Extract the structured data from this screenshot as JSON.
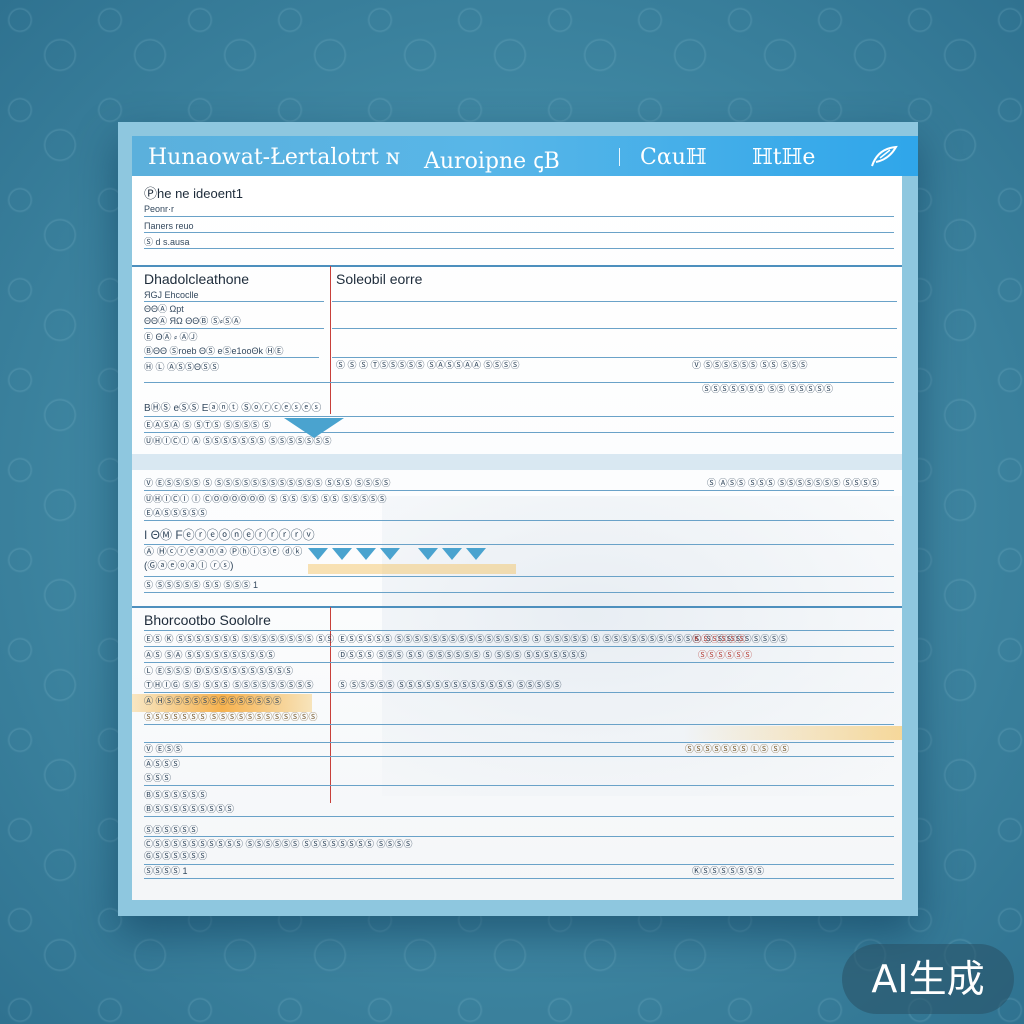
{
  "header": {
    "title_left": "Ηunaowat-Łertalotrt ɴ",
    "title_mid": "Auroipne ꞔΒ",
    "title_c": "Cαuℍ",
    "title_d": "ℍtℍe",
    "leaf_icon": "leaf-icon"
  },
  "section1": {
    "heading": "Ⓟhe ne ideoent1",
    "rows": [
      "Ρeonr·r",
      "Πaners reuo",
      "Ⓢ d s.ausa"
    ]
  },
  "section2": {
    "heading_left": "Dhadolcleathone",
    "heading_right": "Soleobil eorre",
    "left_rows": [
      "ЯGJ Ehcoclle",
      "ΘΘⒶ Ωpt",
      "ΘΘⒶ ЯΩ ΘΘⒷ Ⓢ⸗ⓈⒶ",
      "Ⓔ ΘⒶ ⸗ ⒶⒿ",
      "ⒷΘΘ Ⓢroeb ΘⓈ eⓈe1ooΘk  ⒽⒺ",
      "Ⓗ Ⓛ ⒶⓈⓈΘⓈⓈ"
    ],
    "mid_row": "Ⓢ Ⓢ Ⓢ ⓉⓈⓈⓈⓈⓈ ⓈⒶⓈⓈⒶⒶ ⓈⓈⓈⓈ",
    "right_row1": "Ⓥ ⓈⓈⓈⓈⓈⓈ ⓈⓈ ⓈⓈⓈ",
    "right_row2": "ⓈⓈⓈⓈⓈⓈⓈ ⓈⓈ ⓈⓈⓈⓈⓈ"
  },
  "section3": {
    "heading": "ΒⒽⓈ eⓈⓈ Eⓐⓝⓣ Ⓢⓞⓡⓒⓔⓢⓔⓢ",
    "rows": [
      "ⒺⒶⓈⒶ Ⓢ ⓈⓉⓈ ⓈⓈⓈⓈ Ⓢ",
      "ⓊⒽⒾⒸⒾ Ⓐ ⓈⓈⓈⓈⓈⓈⓈ ⓈⓈⓈⓈⓈⓈⓈ"
    ]
  },
  "section4": {
    "rows": [
      "Ⓥ ⒺⓈⓈⓈⓈ Ⓢ ⓈⓈⓈⓈⓈⓈⓈⓈⓈⓈⓈⓈ ⓈⓈⓈ ⓈⓈⓈⓈ",
      "ⓊⒽⒾⒸⒾ Ⓘ ⒸⓄⓄⓄⓄⓄⓄ Ⓢ ⓈⓈ ⓈⓈ ⓈⓈ ⓈⓈⓈⓈⓈ",
      "ⒺⒶⓈⓈⓈⓈⓈ"
    ],
    "right": "Ⓢ ⒶⓈⓈ ⓈⓈⓈ ⓈⓈⓈⓈⓈⓈⓈ ⓈⓈⓈⓈ"
  },
  "section5": {
    "heading": "I ΘⓂ Fⓔⓡⓔⓞⓝⓔⓡⓡⓡⓡⓥ",
    "rows": [
      "Ⓐ Ⓗⓒⓡⓔⓐⓝⓐ Ⓟⓗⓘⓢⓔ ⓓⓚ",
      "(Ⓖⓐⓔⓞⓐⓛ ⓡⓢ)",
      "Ⓢ  ⓈⓈⓈⓈⓈ ⓈⓈ ⓈⓈⓈ 1"
    ]
  },
  "section6": {
    "heading_left": "Bhorcootbo Soololre",
    "rows_left": [
      "ⒺⓈ Ⓚ ⓈⓈⓈⓈⓈⓈⓈ ⓈⓈⓈⓈⓈⓈⓈⓈ ⓈⓈ",
      "ⒶⓈ ⓈⒶ ⓈⓈⓈⓈⓈⓈⓈⓈⓈⓈ",
      "Ⓛ ⒺⓈⓈⓈ ⒹⓈⓈⓈⓈⓈⓈⓈⓈⓈⓈ",
      "ⓉⒽⒾⒼ ⓈⓈ ⓈⓈⓈ ⓈⓈⓈⓈⓈⓈⓈⓈⓈ",
      "Ⓐ ⒽⓈⓈⓈⓈⓈⓈⓈⓈⓈⓈⓈⓈⓈ",
      "ⓈⓈⓈⓈⓈⓈⓈ ⓈⓈⓈⓈⓈⓈⓈⓈⓈⓈⓈⓈ"
    ],
    "rows_mid": [
      "ⒺⓈⓈⓈⓈⓈ ⓈⓈⓈⓈⓈⓈⓈⓈⓈⓈⓈⓈⓈⓈⓈ Ⓢ ⓈⓈⓈⓈⓈ Ⓢ ⓈⓈⓈⓈⓈⓈⓈⓈⓈⓈⓈ Ⓢ ⓈⓈⓈⓈⓈⓈⓈⓈ",
      "ⒹⓈⓈⓈ ⓈⓈⓈ ⓈⓈ ⓈⓈⓈⓈⓈⓈ Ⓢ ⓈⓈⓈ ⓈⓈⓈⓈⓈⓈⓈ",
      "Ⓢ ⓈⓈⓈⓈⓈ ⓈⓈⓈⓈⓈⓈⓈⓈⓈⓈⓈⓈⓈ ⓈⓈⓈⓈⓈ"
    ],
    "rows_right": [
      "ⓀⓈⓈⓈⓈⓈ",
      "ⓈⓈⓈⓈⓈⓈ"
    ],
    "bottom_left": [
      "Ⓥ ⒺⓈⓈ",
      "ⒶⓈⓈⓈ",
      "ⓈⓈⓈ",
      "ⒷⓈⓈⓈⓈⓈⓈ",
      "ⒷⓈⓈⓈⓈⓈⓈⓈⓈⓈ",
      "ⓈⓈⓈⓈⓈⓈ",
      "ⒸⓈⓈⓈⓈⓈⓈⓈⓈⓈⓈ ⓈⓈⓈⓈⓈⓈ ⓈⓈⓈⓈⓈⓈⓈⓈ ⓈⓈⓈⓈ",
      "ⒼⓈⓈⓈⓈⓈⓈ",
      "ⓈⓈⓈⓈ 1"
    ],
    "bottom_right": [
      "ⓈⓈⓈⓈⓈⓈⓈ ⓁⓈ ⓈⓈ",
      "ⓀⓈⓈⓈⓈⓈⓈⓈ"
    ]
  },
  "badge": "AI生成",
  "colors": {
    "header": "#58b6e8",
    "rule": "#6aa2c8",
    "margin_rule": "#c8403a",
    "highlight": "#f5c25a"
  }
}
